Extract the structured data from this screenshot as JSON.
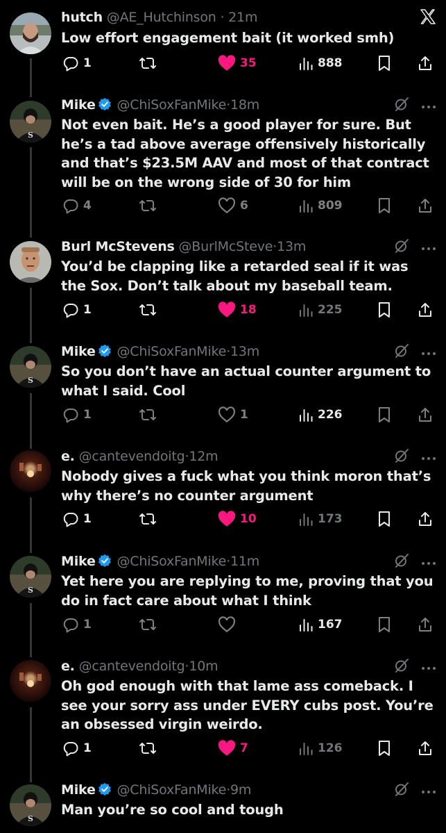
{
  "colors": {
    "background": "#000000",
    "text": "#e7e9ea",
    "muted": "#71767b",
    "like": "#f91880",
    "verified": "#1d9bf0"
  },
  "tweets": [
    {
      "name": "hutch",
      "handle": "@AE_Hutchinson",
      "dot": "·",
      "time": "21m",
      "text": "Low effort engagement bait (it worked smh)",
      "replies": "1",
      "retweets": "",
      "likes": "35",
      "liked": true,
      "views": "888",
      "verified": false
    },
    {
      "name": "Mike",
      "handle": "@ChiSoxFanMike",
      "dot": "·",
      "time": "18m",
      "text": "Not even bait. He’s a good player for sure. But he’s a tad above average offensively historically and that’s $23.5M AAV and most of that contract will be on the wrong side of 30 for him",
      "replies": "4",
      "retweets": "",
      "likes": "6",
      "liked": false,
      "views": "809",
      "verified": true
    },
    {
      "name": "Burl McStevens",
      "handle": "@BurlMcSteve",
      "dot": "·",
      "time": "13m",
      "text": "You’d be clapping like a retarded seal if it was the Sox. Don’t talk about my baseball team.",
      "replies": "1",
      "retweets": "",
      "likes": "18",
      "liked": true,
      "views": "225",
      "verified": false
    },
    {
      "name": "Mike",
      "handle": "@ChiSoxFanMike",
      "dot": "·",
      "time": "13m",
      "text": "So you don’t have an actual counter argument to what I said. Cool",
      "replies": "1",
      "retweets": "",
      "likes": "1",
      "liked": false,
      "views": "226",
      "verified": true
    },
    {
      "name": "e.",
      "handle": "@cantevendoitg",
      "dot": "·",
      "time": "12m",
      "text": "Nobody gives a fuck what you think moron that’s why there’s no counter argument",
      "replies": "1",
      "retweets": "",
      "likes": "10",
      "liked": true,
      "views": "173",
      "verified": false
    },
    {
      "name": "Mike",
      "handle": "@ChiSoxFanMike",
      "dot": "·",
      "time": "11m",
      "text": "Yet here you are replying to me, proving that you do in fact care about what I think",
      "replies": "1",
      "retweets": "",
      "likes": "",
      "liked": false,
      "views": "167",
      "verified": true
    },
    {
      "name": "e.",
      "handle": "@cantevendoitg",
      "dot": "·",
      "time": "10m",
      "text": "Oh god enough with that lame ass comeback. I see your sorry ass under EVERY cubs post. You’re an obsessed virgin weirdo.",
      "replies": "1",
      "retweets": "",
      "likes": "7",
      "liked": true,
      "views": "126",
      "verified": false
    },
    {
      "name": "Mike",
      "handle": "@ChiSoxFanMike",
      "dot": "·",
      "time": "9m",
      "text": "Man you’re so cool and tough",
      "replies": "",
      "retweets": "",
      "likes": "",
      "liked": false,
      "views": "",
      "verified": true
    }
  ],
  "icons": {
    "close": "x-logo-icon",
    "more": "more-icon",
    "grok": "grok-icon",
    "reply": "reply-icon",
    "retweet": "retweet-icon",
    "like": "heart-icon",
    "views": "views-icon",
    "bookmark": "bookmark-icon",
    "share": "share-icon"
  }
}
